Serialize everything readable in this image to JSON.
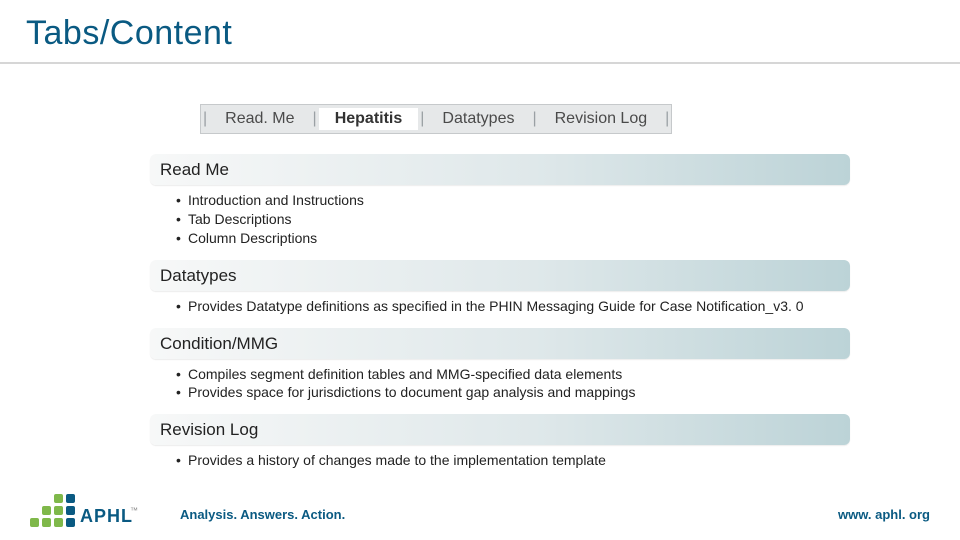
{
  "title": "Tabs/Content",
  "tabs": [
    "Read. Me",
    "Hepatitis",
    "Datatypes",
    "Revision Log"
  ],
  "sections": [
    {
      "heading": "Read Me",
      "items": [
        "Introduction and Instructions",
        "Tab Descriptions",
        "Column Descriptions"
      ]
    },
    {
      "heading": "Datatypes",
      "items": [
        "Provides Datatype definitions as specified in the PHIN Messaging Guide for Case Notification_v3. 0"
      ]
    },
    {
      "heading": "Condition/MMG",
      "items": [
        "Compiles segment definition tables and MMG-specified data elements",
        "Provides space for jurisdictions to document gap analysis and mappings"
      ]
    },
    {
      "heading": "Revision Log",
      "items": [
        "Provides a history of changes made to the implementation template"
      ]
    }
  ],
  "footer": {
    "logo": "APHL",
    "tagline": "Analysis. Answers. Action.",
    "url": "www. aphl. org"
  }
}
